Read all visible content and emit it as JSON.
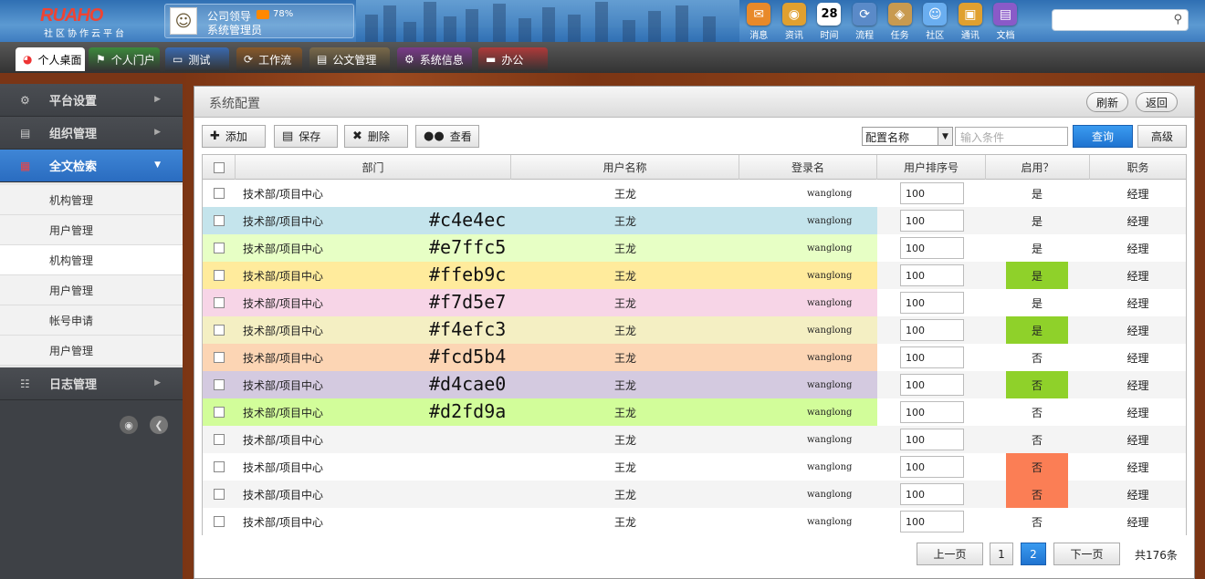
{
  "brand": {
    "logo": "RUAHO",
    "tagline": "社区协作云平台"
  },
  "user": {
    "line1": "公司领导",
    "line2": "系统管理员",
    "percent": "78%"
  },
  "toolbar": [
    {
      "label": "消息",
      "icon": "message-icon",
      "color": "#e8892a"
    },
    {
      "label": "资讯",
      "icon": "news-icon",
      "color": "#e0a030"
    },
    {
      "label": "时间",
      "icon": "calendar-icon",
      "color": "#ffffff",
      "text": "28"
    },
    {
      "label": "流程",
      "icon": "workflow-icon",
      "color": "#5a8ac8"
    },
    {
      "label": "任务",
      "icon": "task-icon",
      "color": "#c89a50"
    },
    {
      "label": "社区",
      "icon": "community-icon",
      "color": "#6aaef0"
    },
    {
      "label": "通讯",
      "icon": "contacts-icon",
      "color": "#e0a030"
    },
    {
      "label": "文档",
      "icon": "document-icon",
      "color": "#8a5ac8"
    }
  ],
  "tabs": [
    {
      "label": "个人桌面",
      "icon": "desktop-icon",
      "color": "#ffffff",
      "active": true
    },
    {
      "label": "个人门户",
      "icon": "portal-icon",
      "color": "#3c8a3c"
    },
    {
      "label": "测试",
      "icon": "monitor-icon",
      "color": "#3a6ab0"
    },
    {
      "label": "工作流",
      "icon": "workflow-icon",
      "color": "#8a5a2a"
    },
    {
      "label": "公文管理",
      "icon": "document-icon",
      "color": "#7a6a4a"
    },
    {
      "label": "系统信息",
      "icon": "gear-icon",
      "color": "#7a3a8a"
    },
    {
      "label": "办公",
      "icon": "briefcase-icon",
      "color": "#b03a3a"
    }
  ],
  "sidebar": {
    "sections": [
      {
        "label": "平台设置",
        "icon": "gear-icon"
      },
      {
        "label": "组织管理",
        "icon": "monitor-icon"
      },
      {
        "label": "全文检索",
        "icon": "grid-icon",
        "active": true
      }
    ],
    "items": [
      "机构管理",
      "用户管理",
      "机构管理",
      "用户管理",
      "帐号申请",
      "用户管理"
    ],
    "log": "日志管理"
  },
  "panel": {
    "title": "系统配置",
    "refresh": "刷新",
    "back": "返回",
    "actions": {
      "add": "添加",
      "save": "保存",
      "delete": "删除",
      "view": "查看"
    },
    "filter": {
      "select": "配置名称",
      "placeholder": "输入条件",
      "query": "查询",
      "advanced": "高级"
    }
  },
  "table": {
    "headers": [
      "部门",
      "用户名称",
      "登录名",
      "用户排序号",
      "启用？",
      "职务"
    ],
    "rows": [
      {
        "dept": "技术部/项目中心",
        "name": "王龙",
        "login": "wanglong",
        "order": "100",
        "enabled": "是",
        "title": "经理",
        "bg": "#ffffff",
        "hex": "",
        "status": ""
      },
      {
        "dept": "技术部/项目中心",
        "name": "王龙",
        "login": "wanglong",
        "order": "100",
        "enabled": "是",
        "title": "经理",
        "bg": "#c4e4ec",
        "hex": "#c4e4ec",
        "status": ""
      },
      {
        "dept": "技术部/项目中心",
        "name": "王龙",
        "login": "wanglong",
        "order": "100",
        "enabled": "是",
        "title": "经理",
        "bg": "#e7ffc5",
        "hex": "#e7ffc5",
        "status": ""
      },
      {
        "dept": "技术部/项目中心",
        "name": "王龙",
        "login": "wanglong",
        "order": "100",
        "enabled": "是",
        "title": "经理",
        "bg": "#ffeb9c",
        "hex": "#ffeb9c",
        "status": "#8fd12a"
      },
      {
        "dept": "技术部/项目中心",
        "name": "王龙",
        "login": "wanglong",
        "order": "100",
        "enabled": "是",
        "title": "经理",
        "bg": "#f7d5e7",
        "hex": "#f7d5e7",
        "status": ""
      },
      {
        "dept": "技术部/项目中心",
        "name": "王龙",
        "login": "wanglong",
        "order": "100",
        "enabled": "是",
        "title": "经理",
        "bg": "#f4efc3",
        "hex": "#f4efc3",
        "status": "#8fd12a"
      },
      {
        "dept": "技术部/项目中心",
        "name": "王龙",
        "login": "wanglong",
        "order": "100",
        "enabled": "否",
        "title": "经理",
        "bg": "#fcd5b4",
        "hex": "#fcd5b4",
        "status": ""
      },
      {
        "dept": "技术部/项目中心",
        "name": "王龙",
        "login": "wanglong",
        "order": "100",
        "enabled": "否",
        "title": "经理",
        "bg": "#d4cae0",
        "hex": "#d4cae0",
        "status": "#8fd12a"
      },
      {
        "dept": "技术部/项目中心",
        "name": "王龙",
        "login": "wanglong",
        "order": "100",
        "enabled": "否",
        "title": "经理",
        "bg": "#d2fd9a",
        "hex": "#d2fd9a",
        "status": ""
      },
      {
        "dept": "技术部/项目中心",
        "name": "王龙",
        "login": "wanglong",
        "order": "100",
        "enabled": "否",
        "title": "经理",
        "bg": "#f4f4f4",
        "hex": "",
        "status": ""
      },
      {
        "dept": "技术部/项目中心",
        "name": "王龙",
        "login": "wanglong",
        "order": "100",
        "enabled": "否",
        "title": "经理",
        "bg": "#ffffff",
        "hex": "",
        "status": "#fb7e55"
      },
      {
        "dept": "技术部/项目中心",
        "name": "王龙",
        "login": "wanglong",
        "order": "100",
        "enabled": "否",
        "title": "经理",
        "bg": "#f4f4f4",
        "hex": "",
        "status": "#fb7e55"
      },
      {
        "dept": "技术部/项目中心",
        "name": "王龙",
        "login": "wanglong",
        "order": "100",
        "enabled": "否",
        "title": "经理",
        "bg": "#ffffff",
        "hex": "",
        "status": ""
      }
    ]
  },
  "pagination": {
    "prev": "上一页",
    "pages": [
      "1",
      "2"
    ],
    "current": "2",
    "next": "下一页",
    "total": "共176条"
  }
}
